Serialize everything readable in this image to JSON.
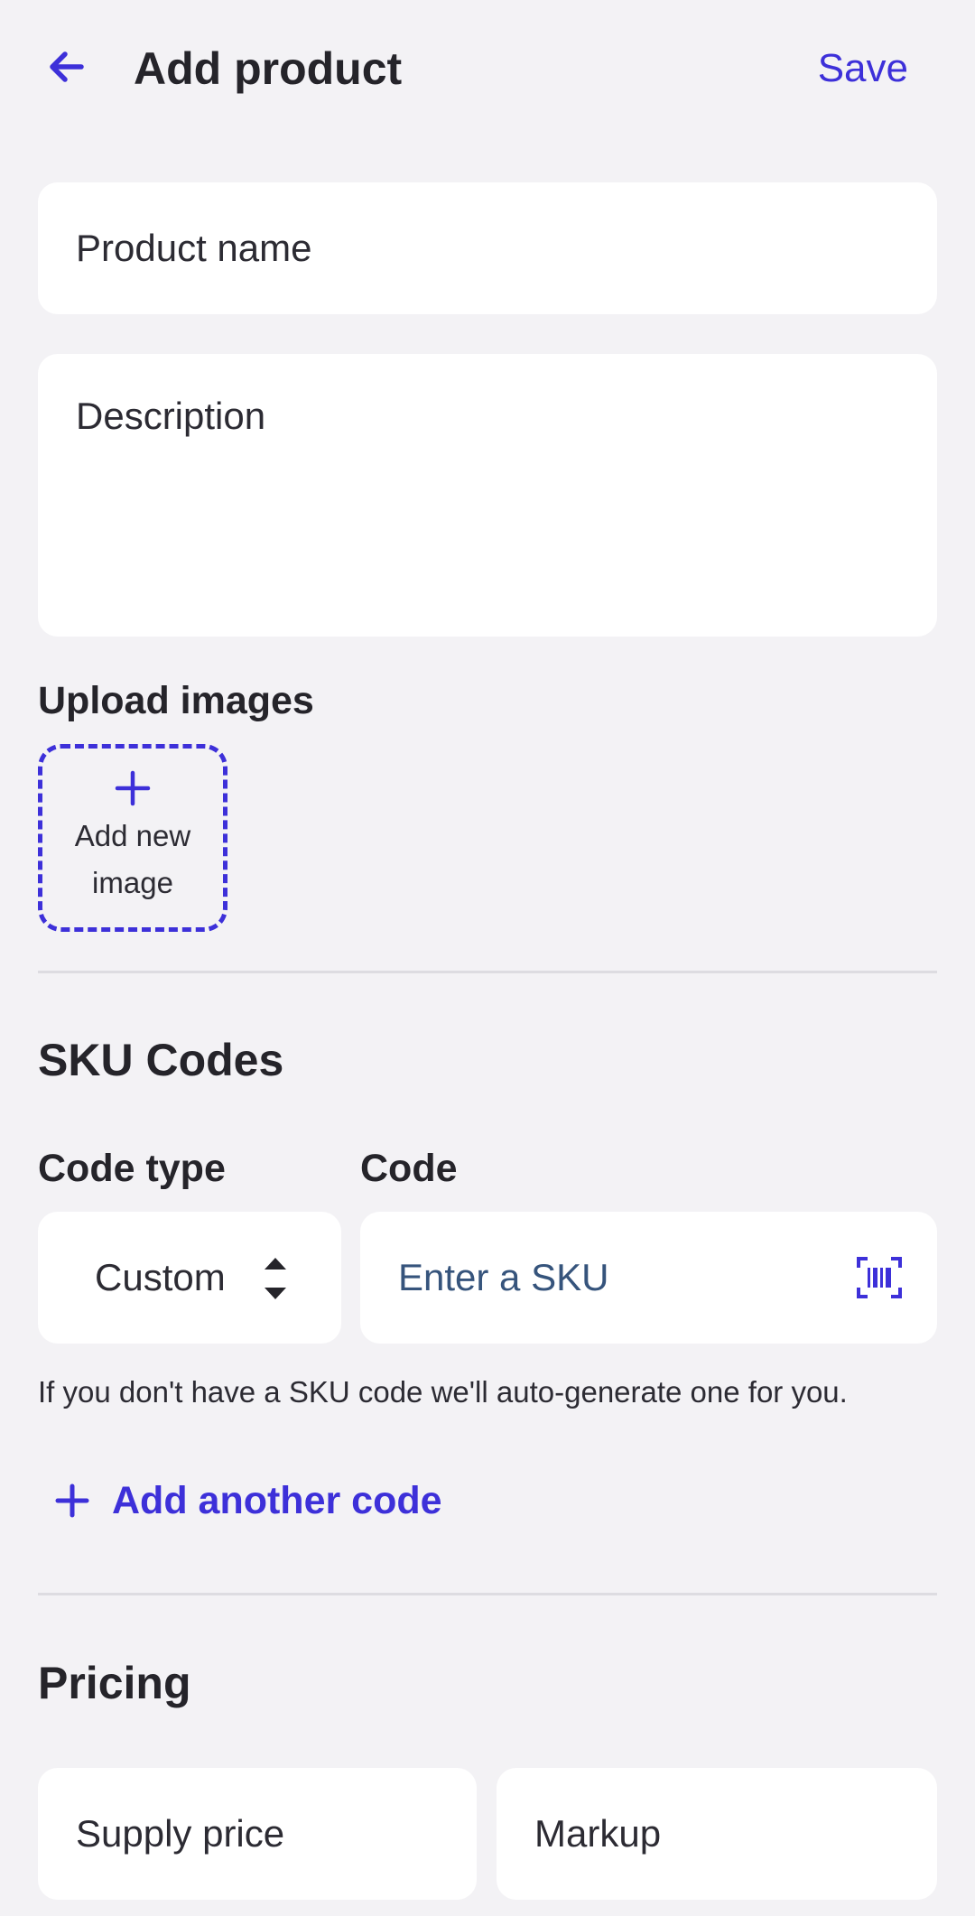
{
  "header": {
    "title": "Add product",
    "save_label": "Save",
    "back_icon": "arrow-left-icon"
  },
  "form": {
    "product_name_placeholder": "Product name",
    "description_placeholder": "Description"
  },
  "upload": {
    "label": "Upload images",
    "add_button_label": "Add new image"
  },
  "sku": {
    "section_title": "SKU Codes",
    "code_type_label": "Code type",
    "code_label": "Code",
    "code_type_value": "Custom",
    "code_placeholder": "Enter a SKU",
    "hint": "If you don't have a SKU code we'll auto-generate one for you.",
    "add_another_label": "Add another code"
  },
  "pricing": {
    "section_title": "Pricing",
    "supply_price_placeholder": "Supply price",
    "markup_placeholder": "Markup"
  },
  "colors": {
    "accent": "#3d30d9",
    "background": "#f3f2f5",
    "card": "#ffffff",
    "text": "#25242a",
    "placeholder_blue": "#36547c"
  }
}
